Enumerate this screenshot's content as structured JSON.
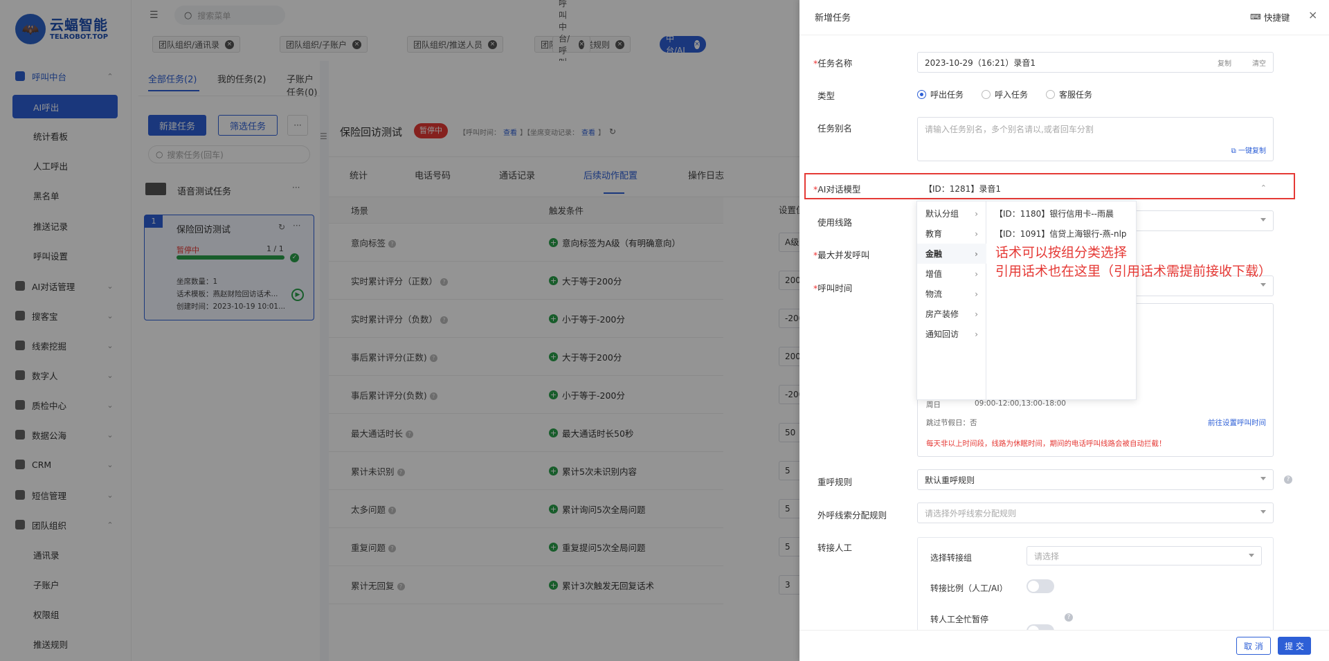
{
  "logo": {
    "name": "云蝠智能",
    "domain": "TELROBOT.TOP"
  },
  "sidebar": {
    "call_center": "呼叫中台",
    "sub": [
      "AI呼出",
      "统计看板",
      "人工呼出",
      "黑名单",
      "推送记录",
      "呼叫设置"
    ],
    "groups": [
      "AI对话管理",
      "搜客宝",
      "线索挖掘",
      "数字人",
      "质检中心",
      "数据公海",
      "CRM",
      "短信管理",
      "团队组织"
    ],
    "team_sub": [
      "通讯录",
      "子账户",
      "权限组",
      "推送规则"
    ]
  },
  "topbar": {
    "search_placeholder": "搜索菜单",
    "tabs": [
      "团队组织/通讯录",
      "团队组织/子账户",
      "团队组织/推送人员",
      "团队组织/推送规则",
      "呼叫中台/呼叫设置",
      "呼叫中台/AI呼出"
    ]
  },
  "main": {
    "task_tabs": [
      "全部任务(2)",
      "我的任务(2)",
      "子账户任务(0)"
    ],
    "new_task": "新建任务",
    "filter_task": "筛选任务",
    "more": "···",
    "search_placeholder": "搜索任务(回车)",
    "group_name": "语音测试任务",
    "task_card": {
      "index": "1",
      "name": "保险回访测试",
      "status": "暂停中",
      "progress": "1 / 1",
      "progress_value": 1.0,
      "seats": "坐席数量：1",
      "template": "话术模板：燕赵财险回访话术...",
      "created": "创建时间：2023-10-19 10:01..."
    },
    "task_header": {
      "title": "保险回访测试",
      "status": "暂停中",
      "call_time": "【呼叫时间：",
      "call_time_link": "查看",
      "seat_change": "】【坐席变动记录：",
      "seat_change_link": "查看",
      "close": "】"
    },
    "detail_tabs": [
      "统计",
      "电话号码",
      "通话记录",
      "后续动作配置",
      "操作日志"
    ],
    "table_headers": [
      "场景",
      "触发条件",
      "设置值"
    ],
    "rows": [
      {
        "scene": "意向标签",
        "cond": "意向标签为A级（有明确意向）",
        "val": "A级"
      },
      {
        "scene": "实时累计评分（正数）",
        "cond": "大于等于200分",
        "val": "200"
      },
      {
        "scene": "实时累计评分（负数）",
        "cond": "小于等于-200分",
        "val": "-200"
      },
      {
        "scene": "事后累计评分(正数)",
        "cond": "大于等于200分",
        "val": "200"
      },
      {
        "scene": "事后累计评分(负数)",
        "cond": "小于等于-200分",
        "val": "-200"
      },
      {
        "scene": "最大通话时长",
        "cond": "最大通话时长50秒",
        "val": "50"
      },
      {
        "scene": "累计未识别",
        "cond": "累计5次未识别内容",
        "val": "5"
      },
      {
        "scene": "太多问题",
        "cond": "累计询问5次全局问题",
        "val": "5"
      },
      {
        "scene": "重复问题",
        "cond": "重复提问5次全局问题",
        "val": "5"
      },
      {
        "scene": "累计无回复",
        "cond": "累计3次触发无回复话术",
        "val": "3"
      }
    ]
  },
  "drawer": {
    "title": "新增任务",
    "shortcut": "快捷键",
    "task_name_label": "任务名称",
    "task_name_value": "2023-10-29（16:21）录音1",
    "copy": "复制",
    "clear": "清空",
    "type_label": "类型",
    "types": [
      "呼出任务",
      "呼入任务",
      "客服任务"
    ],
    "alias_label": "任务别名",
    "alias_placeholder": "请输入任务别名，多个别名请以,或者回车分割",
    "one_click_copy": "一键复制",
    "ai_model_label": "AI对话模型",
    "ai_model_value": "【ID：1281】录音1",
    "route_label": "使用线路",
    "concurrency_label": "最大并发呼叫",
    "call_time_label": "呼叫时间",
    "cascade_left": [
      "默认分组",
      "教育",
      "金融",
      "增值",
      "物流",
      "房产装修",
      "通知回访"
    ],
    "cascade_right": [
      "【ID：1180】银行信用卡--雨晨",
      "【ID：1091】信贷上海银行-燕-nlp"
    ],
    "annotation_line1": "话术可以按组分类选择",
    "annotation_line2": "引用话术也在这里（引用话术需提前接收下载）",
    "sunday": "周日",
    "sunday_time": "09:00-12:00,13:00-18:00",
    "skip_holiday": "跳过节假日：否",
    "goto_calltime": "前往设置呼叫时间",
    "warning": "每天非以上时间段，线路为休眠时间，期间的电话呼叫线路会被自动拦截！",
    "redial_label": "重呼规则",
    "redial_value": "默认重呼规则",
    "lead_label": "外呼线索分配规则",
    "lead_placeholder": "请选择外呼线索分配规则",
    "transfer_label": "转接人工",
    "transfer_group_label": "选择转接组",
    "transfer_group_placeholder": "请选择",
    "transfer_ratio_label": "转接比例（人工/AI）",
    "transfer_busy_label": "转人工全忙暂停",
    "cancel": "取 消",
    "submit": "提 交"
  },
  "colors": {
    "primary": "#2d5fd6",
    "danger": "#e53935",
    "success": "#2aa14a"
  }
}
